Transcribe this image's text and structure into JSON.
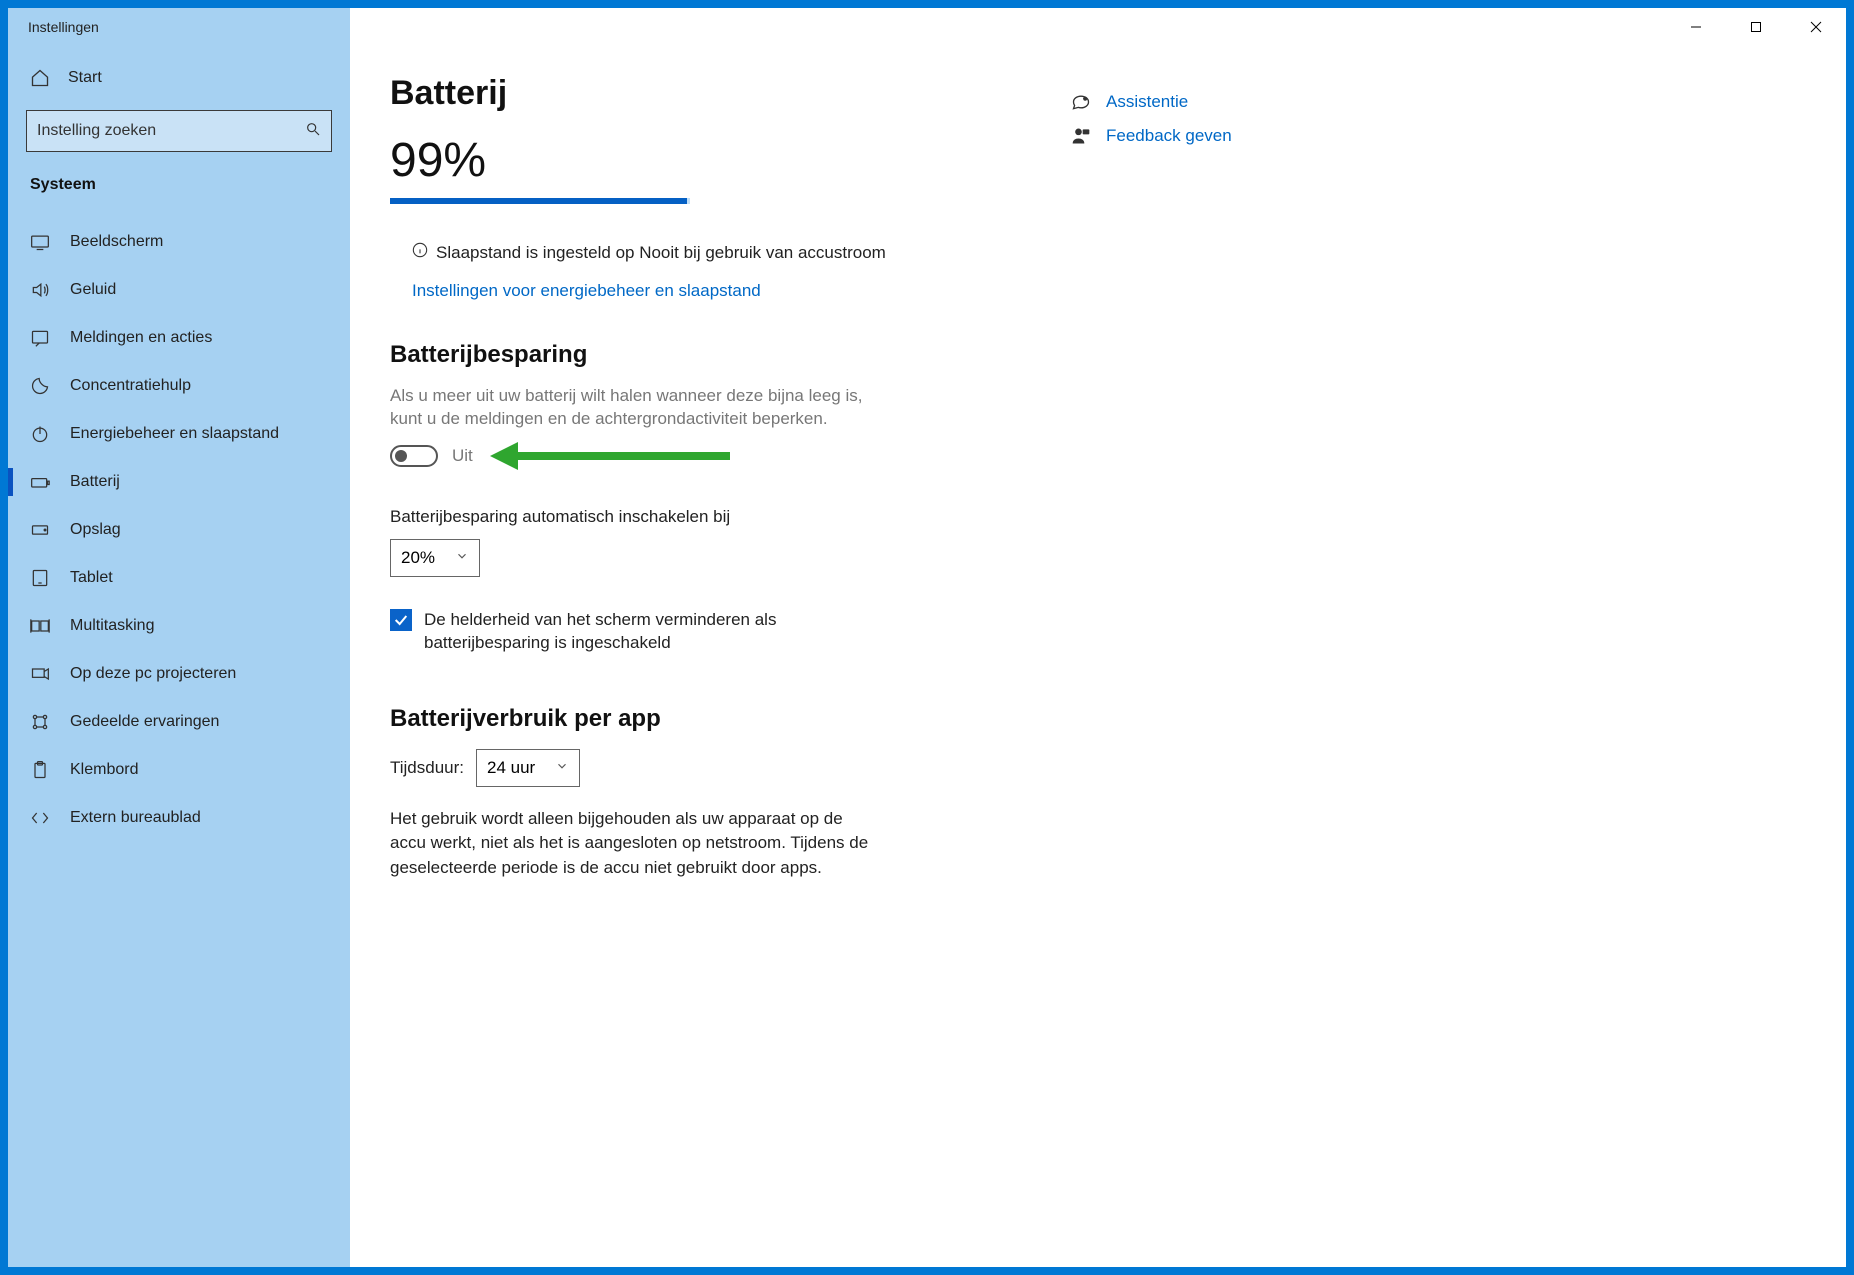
{
  "window": {
    "title": "Instellingen"
  },
  "search": {
    "placeholder": "Instelling zoeken"
  },
  "home": {
    "label": "Start"
  },
  "sidebar": {
    "header": "Systeem",
    "items": [
      {
        "label": "Beeldscherm"
      },
      {
        "label": "Geluid"
      },
      {
        "label": "Meldingen en acties"
      },
      {
        "label": "Concentratiehulp"
      },
      {
        "label": "Energiebeheer en slaapstand"
      },
      {
        "label": "Batterij"
      },
      {
        "label": "Opslag"
      },
      {
        "label": "Tablet"
      },
      {
        "label": "Multitasking"
      },
      {
        "label": "Op deze pc projecteren"
      },
      {
        "label": "Gedeelde ervaringen"
      },
      {
        "label": "Klembord"
      },
      {
        "label": "Extern bureaublad"
      }
    ],
    "active_index": 5
  },
  "main": {
    "title": "Batterij",
    "percent": "99%",
    "progress_pct": 99,
    "sleep_info": "Slaapstand is ingesteld op Nooit bij gebruik van accustroom",
    "power_link": "Instellingen voor energiebeheer en slaapstand",
    "saver": {
      "title": "Batterijbesparing",
      "desc": "Als u meer uit uw batterij wilt halen wanneer deze bijna leeg is, kunt u de meldingen en de achtergrondactiviteit beperken.",
      "toggle_state": "Uit",
      "auto_label": "Batterijbesparing automatisch inschakelen bij",
      "auto_value": "20%",
      "brightness_check": "De helderheid van het scherm verminderen als batterijbesparing is ingeschakeld"
    },
    "usage": {
      "title": "Batterijverbruik per app",
      "duration_label": "Tijdsduur:",
      "duration_value": "24 uur",
      "desc": "Het gebruik wordt alleen bijgehouden als uw apparaat op de accu werkt, niet als het is aangesloten op netstroom. Tijdens de geselecteerde periode is de accu niet gebruikt door apps."
    }
  },
  "right": {
    "assist": "Assistentie",
    "feedback": "Feedback geven"
  }
}
